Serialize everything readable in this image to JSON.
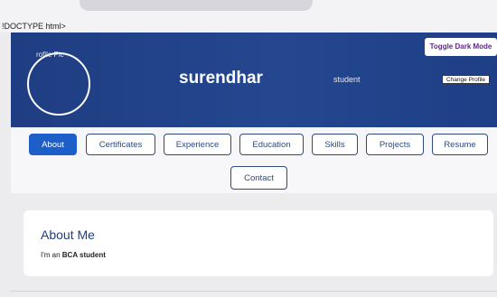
{
  "page": {
    "doctype_text": "!DOCTYPE html>"
  },
  "header": {
    "profile_pic_alt": "rofile Pic",
    "name": "surendhar",
    "role": "student",
    "toggle_dark_mode_label": "Toggle Dark Mode",
    "change_profile_label": "Change Profile"
  },
  "nav": {
    "tabs": [
      {
        "label": "About",
        "active": true
      },
      {
        "label": "Certificates",
        "active": false
      },
      {
        "label": "Experience",
        "active": false
      },
      {
        "label": "Education",
        "active": false
      },
      {
        "label": "Skills",
        "active": false
      },
      {
        "label": "Projects",
        "active": false
      },
      {
        "label": "Resume",
        "active": false
      },
      {
        "label": "Contact",
        "active": false
      }
    ]
  },
  "about": {
    "title": "About Me",
    "text_prefix": "I'm an ",
    "text_bold": "BCA student"
  },
  "colors": {
    "header_bg": "#1f3d82",
    "active_tab": "#1d5fc9",
    "tab_border": "#2e4a7d"
  }
}
